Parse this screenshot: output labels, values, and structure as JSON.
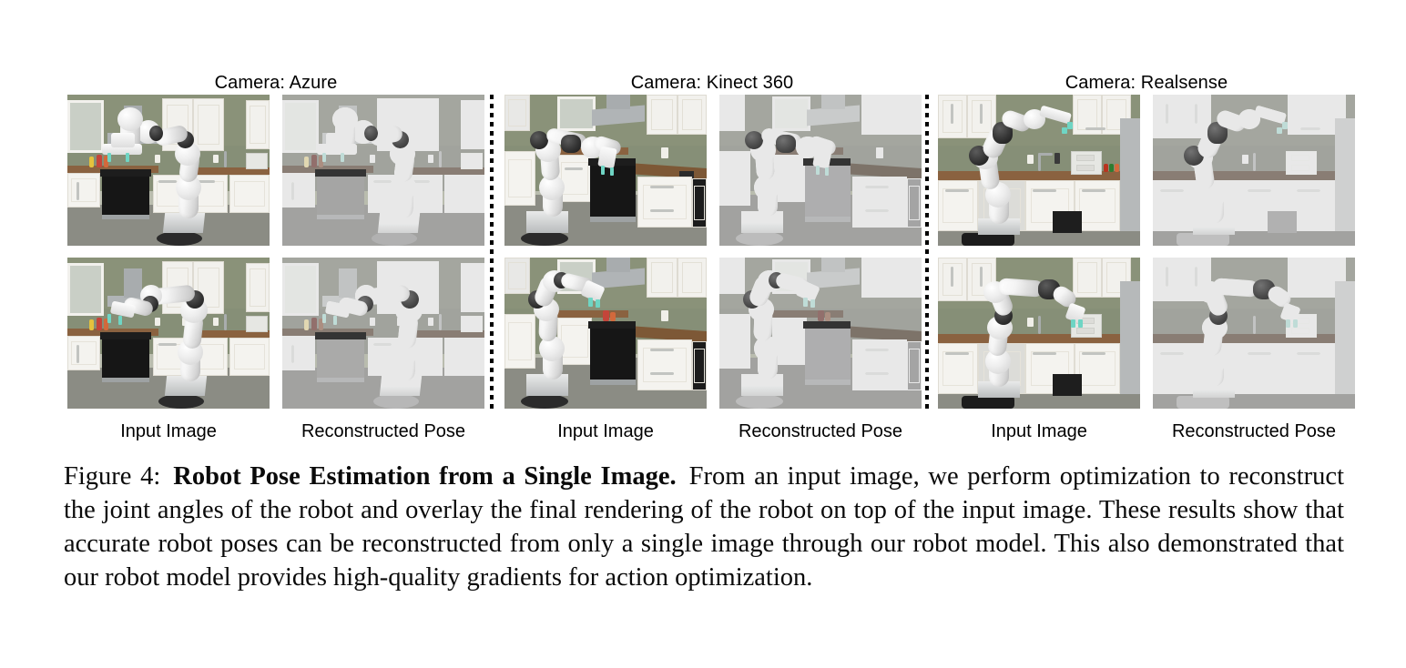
{
  "figure": {
    "columns": [
      {
        "id": "azure",
        "title": "Camera: Azure",
        "panels": [
          {
            "label": "Input Image",
            "kind": "input"
          },
          {
            "label": "Reconstructed Pose",
            "kind": "reconstructed"
          }
        ]
      },
      {
        "id": "kinect360",
        "title": "Camera: Kinect 360",
        "panels": [
          {
            "label": "Input Image",
            "kind": "input"
          },
          {
            "label": "Reconstructed Pose",
            "kind": "reconstructed"
          }
        ]
      },
      {
        "id": "realsense",
        "title": "Camera: Realsense",
        "panels": [
          {
            "label": "Input Image",
            "kind": "input"
          },
          {
            "label": "Reconstructed Pose",
            "kind": "reconstructed"
          }
        ]
      }
    ],
    "rows": 2,
    "scene_description": "White 7-DoF robot arm mounted on a pedestal in a kitchen with green walls, white cabinets, wooden countertop, black oven and a refrigerator.",
    "divider_style": "vertical dotted line"
  },
  "caption": {
    "label": "Figure 4:",
    "title": "Robot Pose Estimation from a Single Image.",
    "body": "From an input image, we perform optimization to reconstruct the joint angles of the robot and overlay the final rendering of the robot on top of the input image. These results show that accurate robot poses can be reconstructed from only a single image through our robot model. This also demonstrated that our robot model provides high-quality gradients for action optimization."
  },
  "colors": {
    "page_background": "#ffffff",
    "text": "#000000",
    "wall_green": "#868f77",
    "cabinet_white": "#f2f1ed",
    "counter_wood": "#8a6240",
    "oven_black": "#161616",
    "floor_gray": "#8b8c84",
    "robot_white": "#f4f4f4",
    "robot_dark_joint": "#2c2c2c",
    "gripper_accent": "#6fd5c4"
  }
}
